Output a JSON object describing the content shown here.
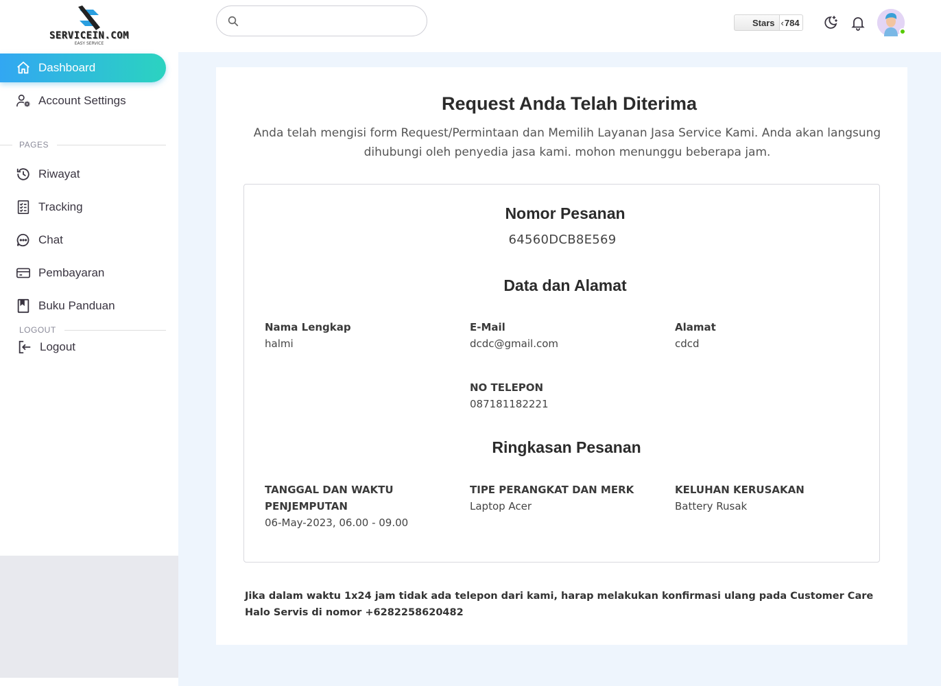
{
  "brand": {
    "logo_text": "SERVICEIN.COM",
    "logo_subtext": "EASY SERVICE"
  },
  "sidebar": {
    "items": [
      {
        "label": "Dashboard",
        "icon": "home-icon",
        "active": true
      },
      {
        "label": "Account Settings",
        "icon": "user-cog-icon"
      }
    ],
    "pages_label": "PAGES",
    "pages": [
      {
        "label": "Riwayat",
        "icon": "history-icon"
      },
      {
        "label": "Tracking",
        "icon": "checklist-icon"
      },
      {
        "label": "Chat",
        "icon": "chat-icon"
      },
      {
        "label": "Pembayaran",
        "icon": "credit-card-icon"
      },
      {
        "label": "Buku Panduan",
        "icon": "book-icon"
      }
    ],
    "logout_label": "LOGOUT",
    "logout": {
      "label": "Logout",
      "icon": "logout-icon"
    }
  },
  "topbar": {
    "search_placeholder": "",
    "stars_label": "Stars",
    "stars_count": "784",
    "icons": [
      "moon-star-icon",
      "bell-icon"
    ],
    "status_color": "#56ca00"
  },
  "main": {
    "title": "Request Anda Telah Diterima",
    "description": "Anda telah mengisi form Request/Permintaan dan Memilih Layanan Jasa Service Kami. Anda akan langsung dihubungi oleh penyedia jasa kami. mohon menunggu beberapa jam.",
    "order_heading": "Nomor Pesanan",
    "order_number": "64560DCB8E569",
    "data_heading": "Data dan Alamat",
    "fields": {
      "name": {
        "label": "Nama Lengkap",
        "value": "halmi"
      },
      "email": {
        "label": "E-Mail",
        "value": "dcdc@gmail.com"
      },
      "address": {
        "label": "Alamat",
        "value": "cdcd"
      },
      "phone": {
        "label": "NO TELEPON",
        "value": "087181182221"
      }
    },
    "summary_heading": "Ringkasan Pesanan",
    "summary": {
      "datetime": {
        "label": "TANGGAL DAN WAKTU PENJEMPUTAN",
        "value": "06-May-2023, 06.00 - 09.00"
      },
      "device": {
        "label": "TIPE PERANGKAT DAN MERK",
        "value": "Laptop Acer"
      },
      "complaint": {
        "label": "KELUHAN KERUSAKAN",
        "value": "Battery Rusak"
      }
    },
    "note": "Jika dalam waktu 1x24 jam tidak ada telepon dari kami, harap melakukan konfirmasi ulang pada Customer Care Halo Servis di nomor +6282258620482"
  },
  "colors": {
    "accent_start": "#32a7f2",
    "accent_end": "#2bd3c0",
    "background": "#eef5fd"
  }
}
